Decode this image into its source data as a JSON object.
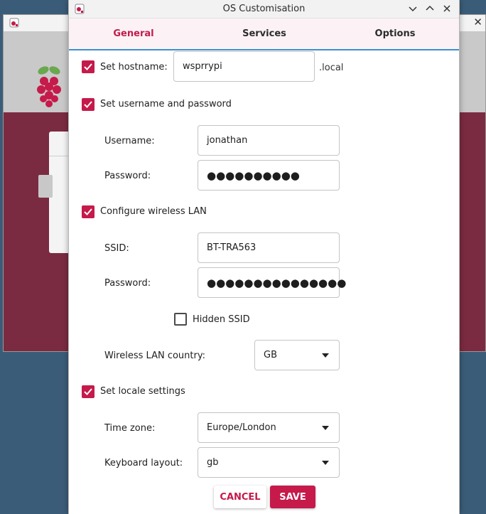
{
  "window": {
    "title": "OS Customisation"
  },
  "tabs": [
    {
      "label": "General",
      "active": true
    },
    {
      "label": "Services",
      "active": false
    },
    {
      "label": "Options",
      "active": false
    }
  ],
  "hostname": {
    "label": "Set hostname:",
    "checked": true,
    "value": "wsprrypi",
    "suffix": ".local"
  },
  "user": {
    "label": "Set username and password",
    "checked": true,
    "username_label": "Username:",
    "username": "jonathan",
    "password_label": "Password:",
    "password_mask": "●●●●●●●●●●"
  },
  "wlan": {
    "label": "Configure wireless LAN",
    "checked": true,
    "ssid_label": "SSID:",
    "ssid": "BT-TRA563",
    "password_label": "Password:",
    "password_mask": "●●●●●●●●●●●●●●●",
    "hidden_label": "Hidden SSID",
    "hidden_checked": false,
    "country_label": "Wireless LAN country:",
    "country": "GB"
  },
  "locale": {
    "label": "Set locale settings",
    "checked": true,
    "timezone_label": "Time zone:",
    "timezone": "Europe/London",
    "keyboard_label": "Keyboard layout:",
    "keyboard": "gb"
  },
  "actions": {
    "cancel": "CANCEL",
    "save": "SAVE"
  },
  "colors": {
    "accent": "#c51a4a",
    "tab_underline": "#3d8fd1",
    "background_app": "#7b2b41"
  }
}
